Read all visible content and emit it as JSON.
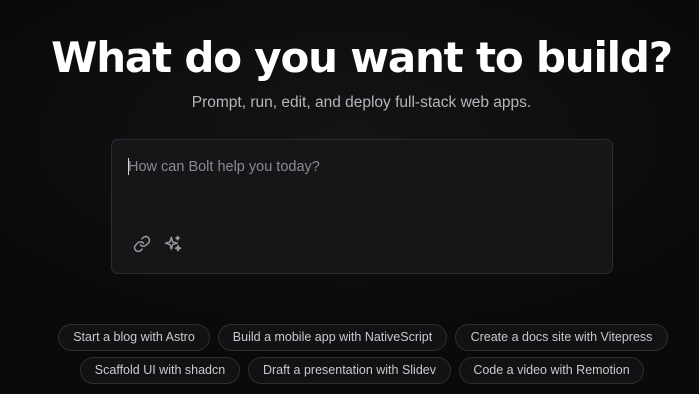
{
  "hero": {
    "title": "What do you want to build?",
    "subtitle": "Prompt, run, edit, and deploy full-stack web apps."
  },
  "prompt": {
    "placeholder": "How can Bolt help you today?",
    "value": "",
    "attach_icon": "link-icon",
    "enhance_icon": "sparkles-icon"
  },
  "suggestions": [
    "Start a blog with Astro",
    "Build a mobile app with NativeScript",
    "Create a docs site with Vitepress",
    "Scaffold UI with shadcn",
    "Draft a presentation with Slidev",
    "Code a video with Remotion"
  ],
  "colors": {
    "background": "#0d0d0e",
    "panel": "#161618",
    "border": "#2c2c30",
    "focus_accent": "#3f6fb8",
    "text_primary": "#ffffff",
    "text_secondary": "#b6b6bb"
  }
}
